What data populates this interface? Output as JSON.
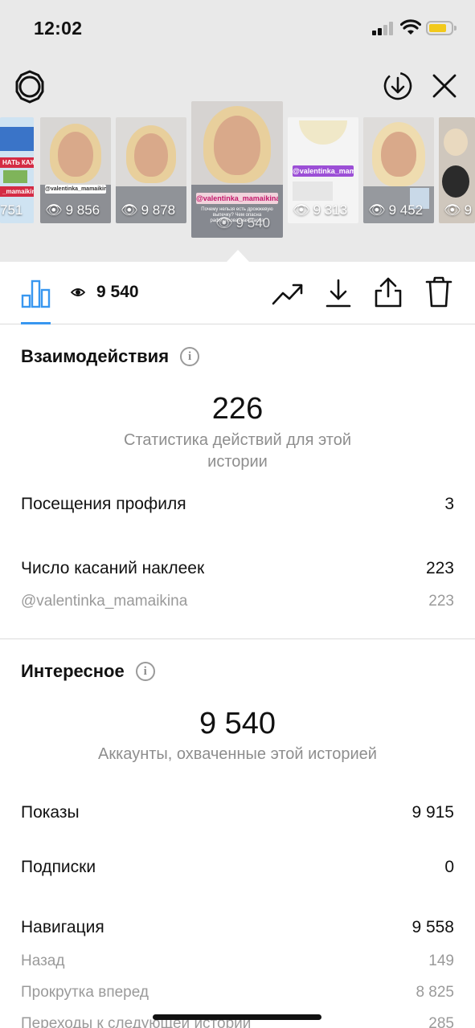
{
  "status_bar": {
    "time": "12:02"
  },
  "stories": [
    {
      "views": "751",
      "type": "text-collage"
    },
    {
      "views": "9 856",
      "type": "face"
    },
    {
      "views": "9 878",
      "type": "face"
    },
    {
      "views": "9 540",
      "type": "face",
      "selected": true,
      "tag": "@valentinka_mamaikina"
    },
    {
      "views": "9 313",
      "type": "post",
      "tag": "@valentinka_mamaikina"
    },
    {
      "views": "9 452",
      "type": "face"
    },
    {
      "views": "9",
      "type": "child"
    }
  ],
  "thumb_texts": {
    "thumb0_red_1": "НАТЬ КАЖДЫЙ",
    "thumb0_red_2": "_mamaikina",
    "thumb1_tag": "@valentinka_mamaikina"
  },
  "toolbar": {
    "views": "9 540"
  },
  "interactions": {
    "title": "Взаимодействия",
    "total": "226",
    "subtitle": "Статистика действий для этой истории",
    "rows": [
      {
        "label": "Посещения профиля",
        "value": "3"
      },
      {
        "label": "Число касаний наклеек",
        "value": "223"
      },
      {
        "label": "@valentinka_mamaikina",
        "value": "223"
      }
    ]
  },
  "discovery": {
    "title": "Интересное",
    "total": "9 540",
    "subtitle": "Аккаунты, охваченные этой историей",
    "rows": [
      {
        "label": "Показы",
        "value": "9 915"
      },
      {
        "label": "Подписки",
        "value": "0"
      },
      {
        "label": "Навигация",
        "value": "9 558"
      },
      {
        "label": "Назад",
        "value": "149"
      },
      {
        "label": "Прокрутка вперед",
        "value": "8 825"
      },
      {
        "label": "Переходы к следующей истории",
        "value": "285"
      }
    ]
  },
  "colors": {
    "accent": "#3897f0",
    "battery": "#f2c91c",
    "tag_text": "#c2186b"
  }
}
